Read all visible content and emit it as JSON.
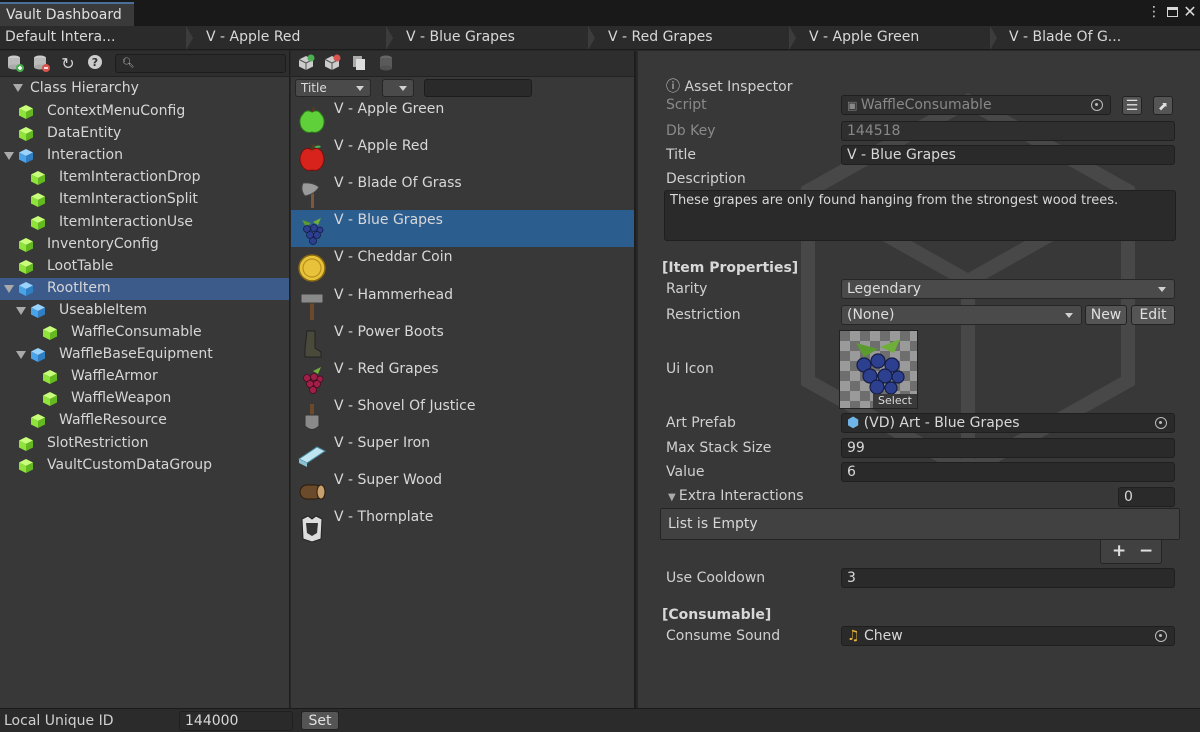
{
  "window": {
    "title": "Vault Dashboard"
  },
  "tabs": [
    "Default Intera...",
    "V - Apple Red",
    "V - Blue Grapes",
    "V - Red Grapes",
    "V - Apple Green",
    "V - Blade Of G..."
  ],
  "hierarchy": {
    "header": "Class Hierarchy",
    "items": [
      {
        "label": "ContextMenuConfig",
        "depth": 1
      },
      {
        "label": "DataEntity",
        "depth": 1
      },
      {
        "label": "Interaction",
        "depth": 1,
        "expanded": true
      },
      {
        "label": "ItemInteractionDrop",
        "depth": 2
      },
      {
        "label": "ItemInteractionSplit",
        "depth": 2
      },
      {
        "label": "ItemInteractionUse",
        "depth": 2
      },
      {
        "label": "InventoryConfig",
        "depth": 1
      },
      {
        "label": "LootTable",
        "depth": 1
      },
      {
        "label": "RootItem",
        "depth": 1,
        "expanded": true,
        "selected": true
      },
      {
        "label": "UseableItem",
        "depth": 2,
        "expanded": true
      },
      {
        "label": "WaffleConsumable",
        "depth": 3
      },
      {
        "label": "WaffleBaseEquipment",
        "depth": 2,
        "expanded": true
      },
      {
        "label": "WaffleArmor",
        "depth": 3
      },
      {
        "label": "WaffleWeapon",
        "depth": 3
      },
      {
        "label": "WaffleResource",
        "depth": 2
      },
      {
        "label": "SlotRestriction",
        "depth": 1
      },
      {
        "label": "VaultCustomDataGroup",
        "depth": 1
      }
    ]
  },
  "assets": {
    "sort_field": "Title",
    "items": [
      {
        "label": "V - Apple Green",
        "icon": "apple-green-icon"
      },
      {
        "label": "V - Apple Red",
        "icon": "apple-red-icon"
      },
      {
        "label": "V - Blade Of Grass",
        "icon": "axe-icon"
      },
      {
        "label": "V - Blue Grapes",
        "icon": "grapes-blue-icon",
        "selected": true
      },
      {
        "label": "V - Cheddar Coin",
        "icon": "coin-icon"
      },
      {
        "label": "V - Hammerhead",
        "icon": "hammer-icon"
      },
      {
        "label": "V - Power Boots",
        "icon": "boots-icon"
      },
      {
        "label": "V - Red Grapes",
        "icon": "grapes-red-icon"
      },
      {
        "label": "V - Shovel Of Justice",
        "icon": "shovel-icon"
      },
      {
        "label": "V - Super Iron",
        "icon": "iron-bar-icon"
      },
      {
        "label": "V - Super Wood",
        "icon": "wood-log-icon"
      },
      {
        "label": "V - Thornplate",
        "icon": "armor-icon"
      }
    ]
  },
  "inspector": {
    "title": "Asset Inspector",
    "script_label": "Script",
    "script_value": "WaffleConsumable",
    "dbkey_label": "Db Key",
    "dbkey_value": "144518",
    "title_label": "Title",
    "title_value": "V - Blue Grapes",
    "desc_label": "Description",
    "desc_value": "These grapes are only found hanging from the strongest wood trees.",
    "item_props_header": "[Item Properties]",
    "rarity_label": "Rarity",
    "rarity_value": "Legendary",
    "restriction_label": "Restriction",
    "restriction_value": "(None)",
    "new_label": "New",
    "edit_label": "Edit",
    "uiicon_label": "Ui Icon",
    "select_label": "Select",
    "artprefab_label": "Art Prefab",
    "artprefab_value": "(VD) Art - Blue Grapes",
    "maxstack_label": "Max Stack Size",
    "maxstack_value": "99",
    "value_label": "Value",
    "value_value": "6",
    "extra_label": "Extra Interactions",
    "extra_count": "0",
    "list_empty": "List is Empty",
    "plus": "+",
    "minus": "−",
    "cooldown_label": "Use Cooldown",
    "cooldown_value": "3",
    "consumable_header": "[Consumable]",
    "sound_label": "Consume Sound",
    "sound_value": "Chew"
  },
  "status": {
    "uid_label": "Local Unique ID",
    "uid_value": "144000",
    "set_label": "Set"
  }
}
